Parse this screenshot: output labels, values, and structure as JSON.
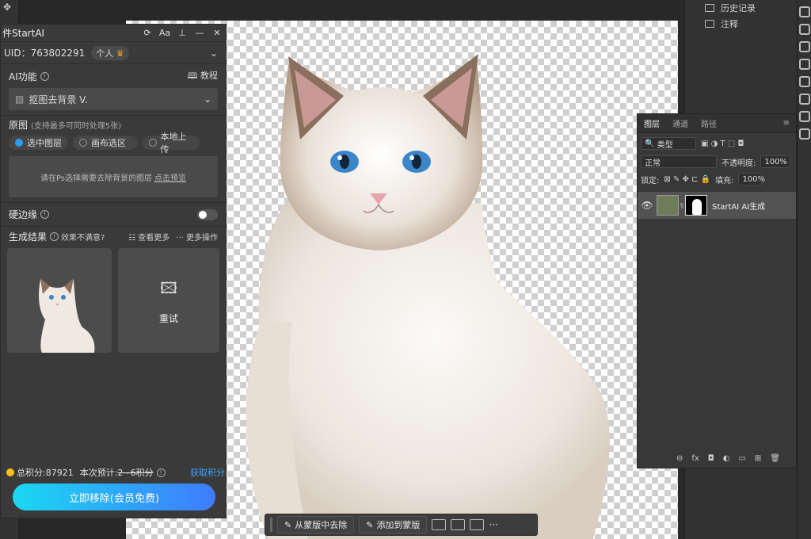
{
  "plugin": {
    "title": "件StartAI",
    "header_buttons": [
      "⟳",
      "Aa",
      "⊥",
      "—",
      "✕"
    ],
    "uid_label": "UID：",
    "uid_value": "763802291",
    "account_type": "个人",
    "ai_function_label": "AI功能",
    "tutorial_label": "教程",
    "selected_function": "抠图去背景 V.",
    "source_label": "原图",
    "source_hint": "(支持最多可同时处理5张)",
    "source_options": [
      "选中图层",
      "画布选区",
      "本地上传"
    ],
    "dropzone_text": "请在Ps选择需要去除背景的图层",
    "dropzone_link": "点击预览",
    "hard_edge_label": "硬边缘",
    "result_label": "生成结果",
    "dissatisfied_label": "效果不满意?",
    "view_more_label": "查看更多",
    "more_actions_label": "··· 更多操作",
    "retry_label": "重试",
    "total_points": "总积分:87921",
    "estimate_label": "本次预计:",
    "estimate_value": "2~6积分",
    "get_points_label": "获取积分",
    "cta_label": "立即移除(会员免费)"
  },
  "history_panel": {
    "items": [
      "历史记录",
      "注释"
    ]
  },
  "layers_panel": {
    "tabs": [
      "图层",
      "通道",
      "路径"
    ],
    "filter_label": "类型",
    "blend_mode": "正常",
    "opacity_label": "不透明度:",
    "opacity_value": "100%",
    "lock_label": "锁定:",
    "fill_label": "填充:",
    "fill_value": "100%",
    "layer_name": "StartAI AI生成",
    "bottom_icons": [
      "⊖",
      "fx",
      "◘",
      "◐",
      "▭",
      "⊞",
      "🗑"
    ]
  },
  "context_bar": {
    "remove_from_mask": "从蒙版中去除",
    "add_to_mask": "添加到蒙版",
    "more": "···"
  },
  "colors": {
    "accent": "#2d9cf0",
    "points_coin": "#f5c21b",
    "get_points": "#3da3ff"
  }
}
